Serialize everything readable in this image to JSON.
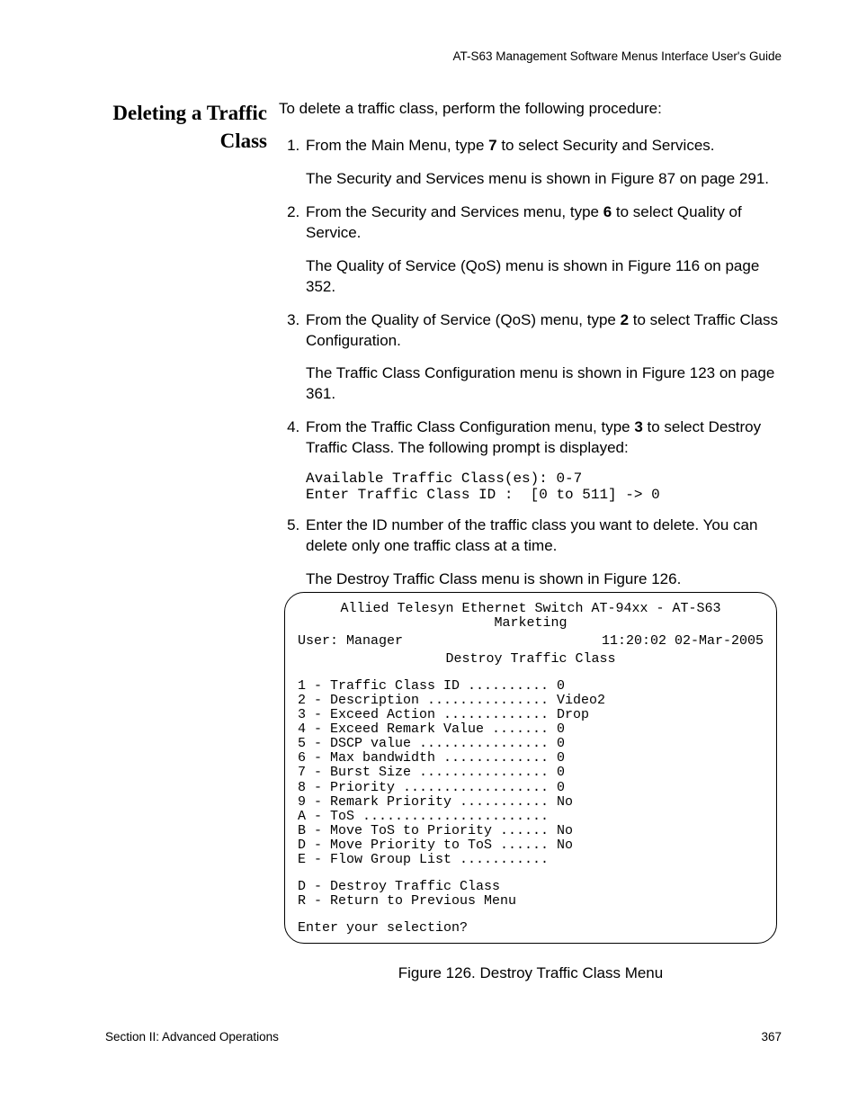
{
  "running_head": "AT-S63 Management Software Menus Interface User's Guide",
  "section_title_line1": "Deleting a Traffic",
  "section_title_line2": "Class",
  "intro": "To delete a traffic class, perform the following procedure:",
  "steps": {
    "s1_a": "From the Main Menu, type ",
    "s1_b": "7",
    "s1_c": " to select Security and Services.",
    "s1_p": "The Security and Services menu is shown in Figure 87 on page 291.",
    "s2_a": "From the Security and Services menu, type ",
    "s2_b": "6",
    "s2_c": " to select Quality of Service.",
    "s2_p": "The Quality of Service (QoS) menu is shown in Figure 116 on page 352.",
    "s3_a": "From the Quality of Service (QoS) menu, type ",
    "s3_b": "2",
    "s3_c": " to select Traffic Class Configuration.",
    "s3_p": "The Traffic Class Configuration menu is shown in Figure 123 on page 361.",
    "s4_a": "From the Traffic Class Configuration menu, type ",
    "s4_b": "3",
    "s4_c": " to select Destroy Traffic Class. The following prompt is displayed:",
    "s4_prompt": "Available Traffic Class(es): 0-7\nEnter Traffic Class ID :  [0 to 511] -> 0",
    "s5": "Enter the ID number of the traffic class you want to delete. You can delete only one traffic class at a time.",
    "s5_p": "The Destroy Traffic Class menu is shown in Figure 126."
  },
  "menu": {
    "head1": "Allied Telesyn Ethernet Switch AT-94xx - AT-S63",
    "head2": "Marketing",
    "user": "User: Manager",
    "timestamp": "11:20:02 02-Mar-2005",
    "title": "Destroy Traffic Class",
    "items": "1 - Traffic Class ID .......... 0\n2 - Description ............... Video2\n3 - Exceed Action ............. Drop\n4 - Exceed Remark Value ....... 0\n5 - DSCP value ................ 0\n6 - Max bandwidth ............. 0\n7 - Burst Size ................ 0\n8 - Priority .................. 0\n9 - Remark Priority ........... No\nA - ToS .......................\nB - Move ToS to Priority ...... No\nD - Move Priority to ToS ...... No\nE - Flow Group List ...........",
    "actions": "D - Destroy Traffic Class\nR - Return to Previous Menu",
    "prompt": "Enter your selection?"
  },
  "figure_caption": "Figure 126. Destroy Traffic Class Menu",
  "footer_left": "Section II: Advanced Operations",
  "footer_right": "367"
}
